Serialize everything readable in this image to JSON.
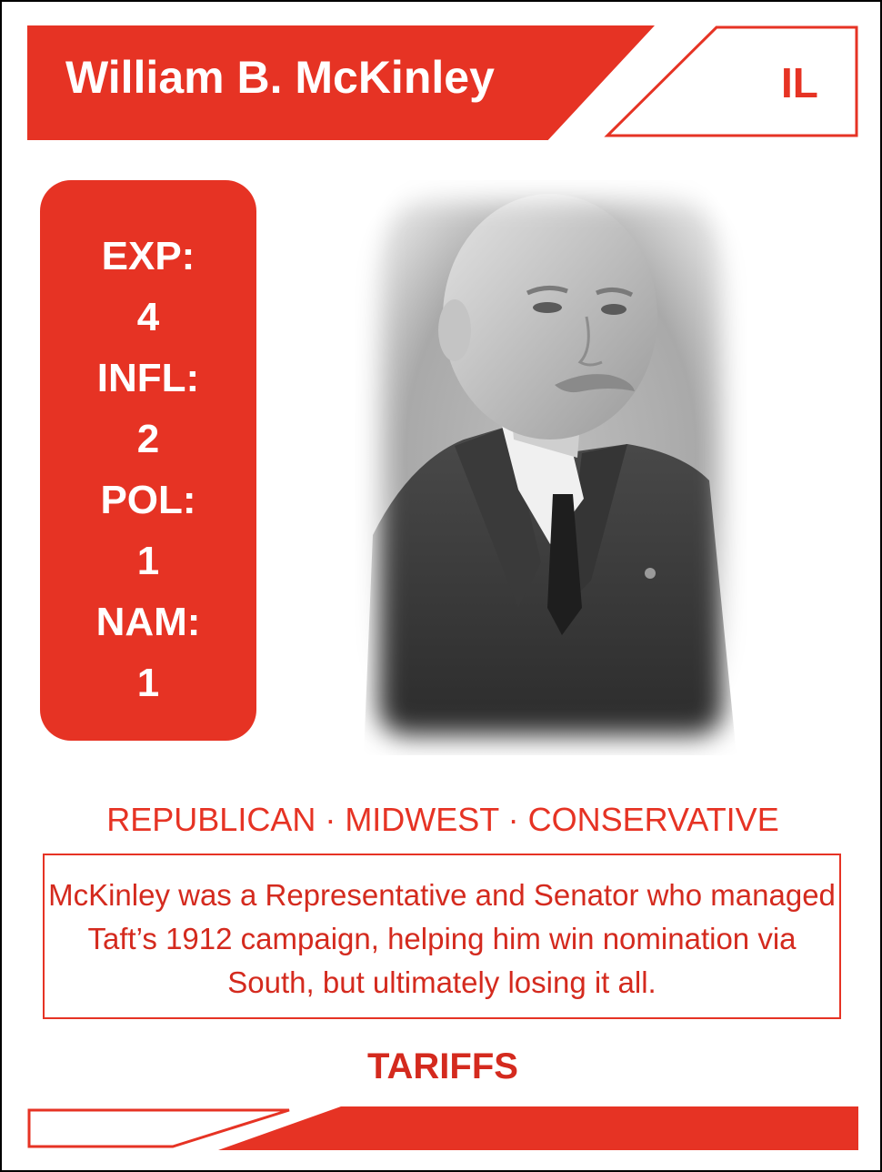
{
  "card": {
    "name": "William B. McKinley",
    "state": "IL",
    "stats": [
      {
        "label": "EXP:",
        "value": "4"
      },
      {
        "label": "INFL:",
        "value": "2"
      },
      {
        "label": "POL:",
        "value": "1"
      },
      {
        "label": "NAM:",
        "value": "1"
      }
    ],
    "tags": "REPUBLICAN · MIDWEST · CONSERVATIVE",
    "description": "McKinley was a Representative and Senator who managed Taft’s 1912 campaign, helping him win nomination via South, but ultimately losing it all.",
    "topic": "TARIFFS"
  },
  "colors": {
    "accent": "#e63324",
    "text_red": "#d42a1e",
    "background": "#ffffff"
  }
}
